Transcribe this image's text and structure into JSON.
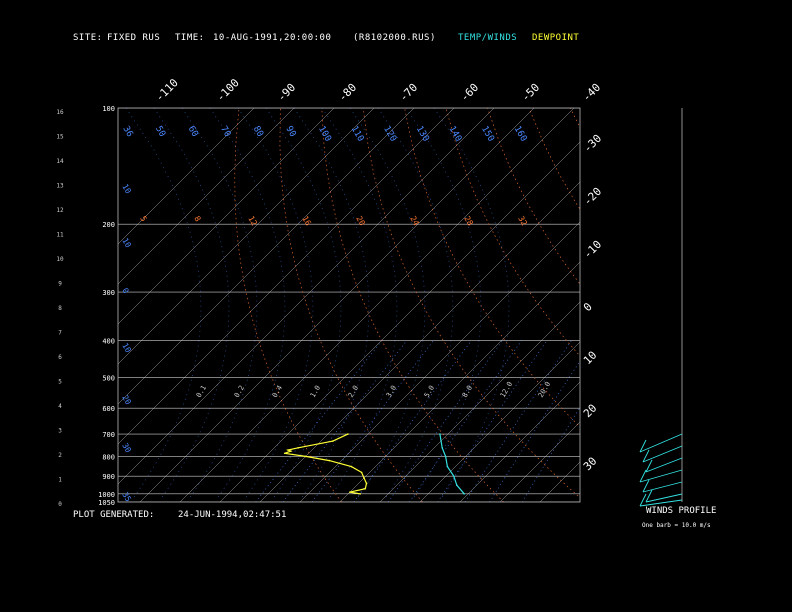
{
  "header": {
    "site_label": "SITE:",
    "site_value": "FIXED RUS",
    "time_label": "TIME:",
    "time_value": "10-AUG-1991,20:00:00",
    "file_id": "(R8102000.RUS)",
    "temp_legend": "TEMP/WINDS",
    "dew_legend": "DEWPOINT"
  },
  "footer": {
    "generated_label": "PLOT GENERATED:",
    "generated_value": "24-JUN-1994,02:47:51",
    "wind_title": "WINDS PROFILE",
    "wind_note": "One barb = 10.0 m/s"
  },
  "colors": {
    "background": "#000000",
    "temp": "#33e0e0",
    "dewpoint": "#ffff33",
    "isobar": "#ffffff",
    "mixing_ratio": "#4a88ff",
    "adiabat": "#ff7733",
    "axis_text": "#ffffff"
  },
  "chart_data": {
    "type": "line",
    "subtype": "skew-T log-P diagram",
    "pressure_levels": [
      "100",
      "200",
      "300",
      "400",
      "500",
      "600",
      "700",
      "800",
      "900",
      "1000",
      "1050"
    ],
    "height_km_labels": [
      "16",
      "15",
      "14",
      "13",
      "12",
      "11",
      "10",
      "9",
      "8",
      "7",
      "6",
      "5",
      "4",
      "3",
      "2",
      "1",
      "0"
    ],
    "isotherm_top_labels": [
      "-110",
      "-100",
      "-90",
      "-80",
      "-70",
      "-60",
      "-50",
      "-40"
    ],
    "isotherm_right_labels": [
      "-30",
      "-20",
      "-10",
      "0",
      "10",
      "20",
      "30"
    ],
    "mixing_ratio_labels": [
      "0.1",
      "0.2",
      "0.4",
      "1.0",
      "2.0",
      "3.0",
      "5.0",
      "8.0",
      "12.0",
      "20.0"
    ],
    "adiabat_labels_top": [
      "36",
      "50",
      "60",
      "70",
      "80",
      "90",
      "100",
      "110",
      "120",
      "130",
      "140",
      "150",
      "160"
    ],
    "adiabat_labels_200": [
      "5",
      "8",
      "12",
      "16",
      "20",
      "24",
      "28",
      "32"
    ],
    "adiabat_labels_left": [
      "16",
      "10",
      "10",
      "0",
      "10",
      "20",
      "30",
      "35"
    ],
    "series": [
      {
        "name": "TEMP/WINDS",
        "points": [
          [
            700,
            -12
          ],
          [
            760,
            -8
          ],
          [
            800,
            -5
          ],
          [
            850,
            -2
          ],
          [
            900,
            2
          ],
          [
            950,
            5
          ],
          [
            1000,
            9
          ]
        ]
      },
      {
        "name": "DEWPOINT",
        "points": [
          [
            700,
            -35
          ],
          [
            730,
            -37
          ],
          [
            760,
            -44
          ],
          [
            770,
            -46
          ],
          [
            775,
            -45
          ],
          [
            785,
            -46
          ],
          [
            800,
            -40
          ],
          [
            820,
            -33
          ],
          [
            850,
            -26
          ],
          [
            880,
            -22
          ],
          [
            910,
            -20
          ],
          [
            940,
            -18
          ],
          [
            970,
            -17
          ],
          [
            990,
            -20
          ],
          [
            1000,
            -17
          ]
        ]
      }
    ],
    "winds_profile": {
      "title": "WINDS PROFILE",
      "note": "One barb = 10.0 m/s"
    }
  }
}
